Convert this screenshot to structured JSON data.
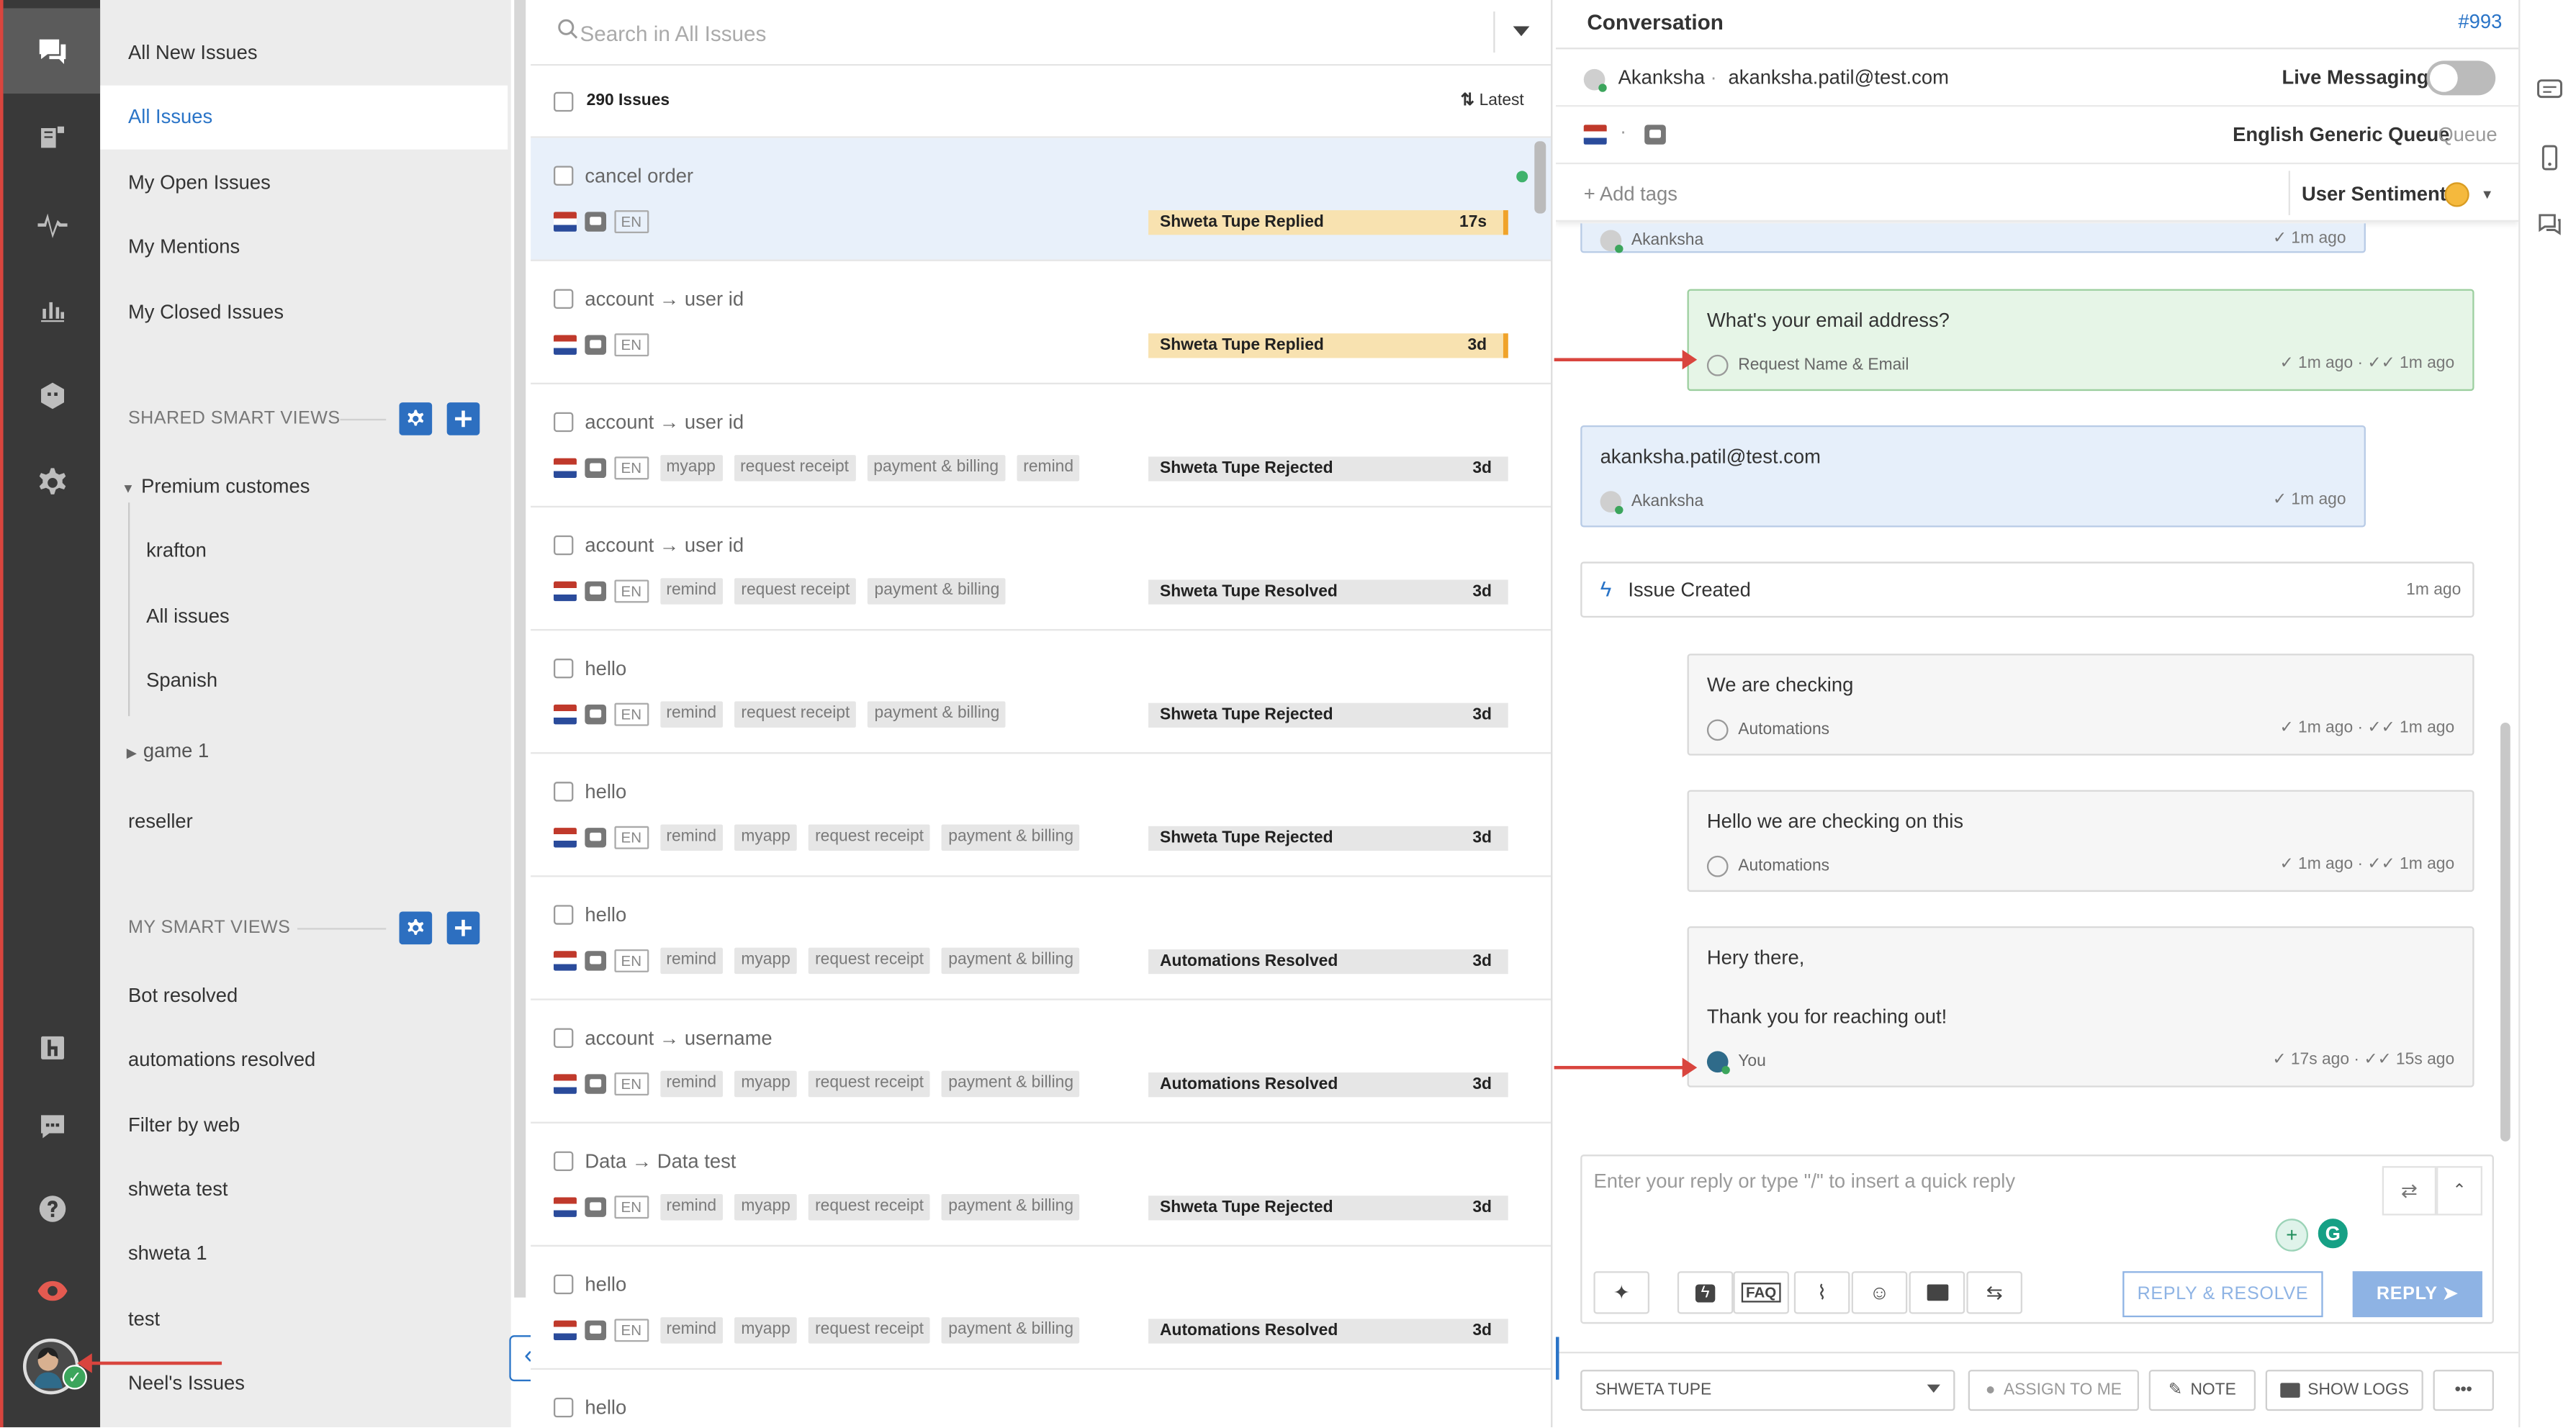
{
  "nav": {
    "main_items": [
      "All New Issues",
      "All Issues",
      "My Open Issues",
      "My Mentions",
      "My Closed Issues"
    ],
    "shared_title": "SHARED SMART VIEWS",
    "shared_group": "Premium customes",
    "shared_children": [
      "krafton",
      "All issues",
      "Spanish"
    ],
    "shared_group2": "game 1",
    "shared_reseller": "reseller",
    "my_title": "MY SMART VIEWS",
    "my_items": [
      "Bot resolved",
      "automations resolved",
      "Filter by web",
      "shweta test",
      "shweta 1",
      "test",
      "Neel's Issues"
    ]
  },
  "list": {
    "search_placeholder": "Search in All Issues",
    "count": "290 Issues",
    "sort": "Latest",
    "lang": "EN",
    "rows": [
      {
        "title": "cancel order",
        "tags": [],
        "status": "Shweta Tupe Replied",
        "age": "17s"
      },
      {
        "title": "account → user id",
        "tags": [],
        "status": "Shweta Tupe Replied",
        "age": "3d"
      },
      {
        "title": "account → user id",
        "tags": [
          "myapp",
          "request receipt",
          "payment & billing",
          "remind"
        ],
        "status": "Shweta Tupe Rejected",
        "age": "3d"
      },
      {
        "title": "account → user id",
        "tags": [
          "remind",
          "request receipt",
          "payment & billing"
        ],
        "status": "Shweta Tupe Resolved",
        "age": "3d"
      },
      {
        "title": "hello",
        "tags": [
          "remind",
          "request receipt",
          "payment & billing"
        ],
        "status": "Shweta Tupe Rejected",
        "age": "3d"
      },
      {
        "title": "hello",
        "tags": [
          "remind",
          "myapp",
          "request receipt",
          "payment & billing"
        ],
        "status": "Shweta Tupe Rejected",
        "age": "3d"
      },
      {
        "title": "hello",
        "tags": [
          "remind",
          "myapp",
          "request receipt",
          "payment & billing"
        ],
        "status": "Automations Resolved",
        "age": "3d"
      },
      {
        "title": "account → username",
        "tags": [
          "remind",
          "myapp",
          "request receipt",
          "payment & billing"
        ],
        "status": "Automations Resolved",
        "age": "3d"
      },
      {
        "title": "Data → Data test",
        "tags": [
          "remind",
          "myapp",
          "request receipt",
          "payment & billing"
        ],
        "status": "Shweta Tupe Rejected",
        "age": "3d"
      },
      {
        "title": "hello",
        "tags": [
          "remind",
          "myapp",
          "request receipt",
          "payment & billing"
        ],
        "status": "Automations Resolved",
        "age": "3d"
      },
      {
        "title": "hello",
        "tags": [],
        "status": "",
        "age": ""
      }
    ]
  },
  "conv": {
    "title": "Conversation",
    "id": "#993",
    "user_name": "Akanksha",
    "user_email": "akanksha.patil@test.com",
    "live_label": "Live Messaging",
    "queue_name": "English Generic Queue",
    "queue_suffix": "Queue",
    "add_tags": "+ Add tags",
    "sentiment": "User Sentiment",
    "top_author": "Akanksha",
    "top_time": "1m ago",
    "m1_text": "What's your email address?",
    "m1_author": "Request Name & Email",
    "m1_t1": "1m ago",
    "m1_t2": "1m ago",
    "m2_text": "akanksha.patil@test.com",
    "m2_author": "Akanksha",
    "m2_t1": "1m ago",
    "event_text": "Issue Created",
    "event_time": "1m ago",
    "m3_text": "We are checking",
    "m3_author": "Automations",
    "m3_t1": "1m ago",
    "m3_t2": "1m ago",
    "m4_text": "Hello we are checking on this",
    "m4_author": "Automations",
    "m4_t1": "1m ago",
    "m4_t2": "1m ago",
    "m5_line1": "Hery there,",
    "m5_line2": "Thank you for reaching out!",
    "m5_author": "You",
    "m5_t1": "17s ago",
    "m5_t2": "15s ago",
    "reply_placeholder": "Enter your reply or type \"/\" to insert a quick reply",
    "faq": "FAQ",
    "reply_resolve": "REPLY & RESOLVE",
    "reply": "REPLY",
    "assignee": "SHWETA TUPE",
    "assign_me": "ASSIGN TO ME",
    "note": "NOTE",
    "show_logs": "SHOW LOGS",
    "more": "•••"
  },
  "colors": {
    "accent": "#2a74c7",
    "rail": "#393939",
    "warn": "#f8e2b0",
    "arrow": "#d9453e"
  }
}
